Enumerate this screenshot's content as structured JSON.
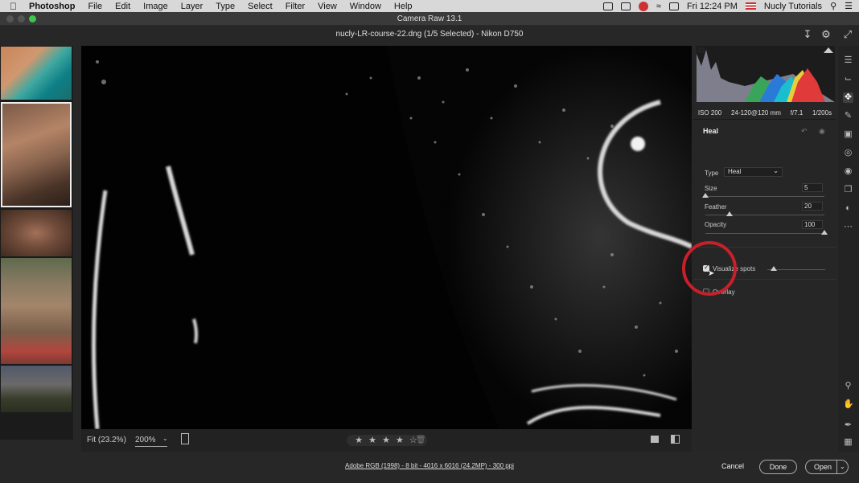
{
  "menubar": {
    "apple": "",
    "app": "Photoshop",
    "items": [
      "File",
      "Edit",
      "Image",
      "Layer",
      "Type",
      "Select",
      "Filter",
      "View",
      "Window",
      "Help"
    ],
    "clock": "Fri 12:24 PM",
    "user": "Nucly Tutorials"
  },
  "window": {
    "title": "Camera Raw 13.1",
    "document_title": "nucly-LR-course-22.dng (1/5 Selected)  -  Nikon D750"
  },
  "exif": {
    "iso": "ISO 200",
    "lens": "24-120@120 mm",
    "aperture": "f/7.1",
    "shutter": "1/200s"
  },
  "heal": {
    "title": "Heal",
    "type_label": "Type",
    "type_value": "Heal",
    "size_label": "Size",
    "size_value": "5",
    "size_fraction": 0.0,
    "feather_label": "Feather",
    "feather_value": "20",
    "feather_fraction": 0.2,
    "opacity_label": "Opacity",
    "opacity_value": "100",
    "opacity_fraction": 1.0,
    "visualize_label": "Visualize spots",
    "visualize_checked": true,
    "overlay_label": "Overlay",
    "overlay_checked": false
  },
  "canvas_bar": {
    "fit_label": "Fit (23.2%)",
    "zoom_value": "200%",
    "stars": "★ ★ ★ ★ ☆"
  },
  "footer": {
    "info": "Adobe RGB (1998) - 8 bit - 4016 x 6016 (24.2MP) - 300 ppi",
    "cancel": "Cancel",
    "done": "Done",
    "open": "Open"
  },
  "colors": {
    "highlight_ring": "#c8202a",
    "accent": "#ffffff"
  }
}
